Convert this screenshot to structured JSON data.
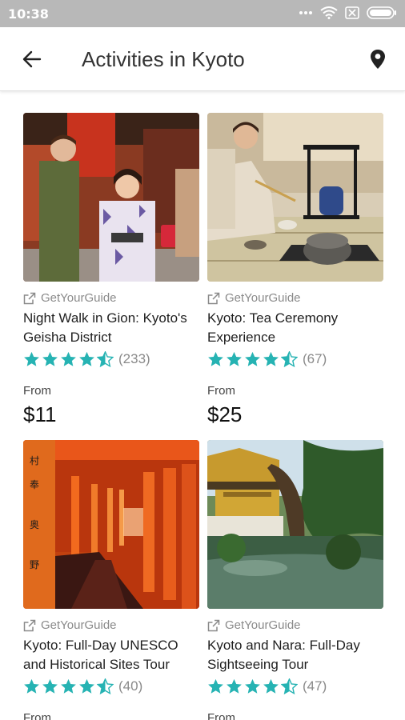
{
  "status": {
    "time": "10:38"
  },
  "header": {
    "title": "Activities in Kyoto"
  },
  "colors": {
    "star": "#26b3b3",
    "status_bar": "#b8b8b8"
  },
  "icons": {
    "back": "arrow-back-icon",
    "map": "map-pin-icon",
    "provider": "external-link-icon"
  },
  "activities": [
    {
      "provider": "GetYourGuide",
      "title": "Night Walk in Gion: Kyoto's Geisha District",
      "rating": 4.5,
      "reviews": "(233)",
      "from_label": "From",
      "price": "$11"
    },
    {
      "provider": "GetYourGuide",
      "title": "Kyoto: Tea Ceremony Experience",
      "rating": 4.5,
      "reviews": "(67)",
      "from_label": "From",
      "price": "$25"
    },
    {
      "provider": "GetYourGuide",
      "title": "Kyoto: Full-Day UNESCO and Historical Sites Tour",
      "rating": 4.5,
      "reviews": "(40)",
      "from_label": "From",
      "price": ""
    },
    {
      "provider": "GetYourGuide",
      "title": "Kyoto and Nara: Full-Day Sightseeing Tour",
      "rating": 4.5,
      "reviews": "(47)",
      "from_label": "From",
      "price": ""
    }
  ]
}
